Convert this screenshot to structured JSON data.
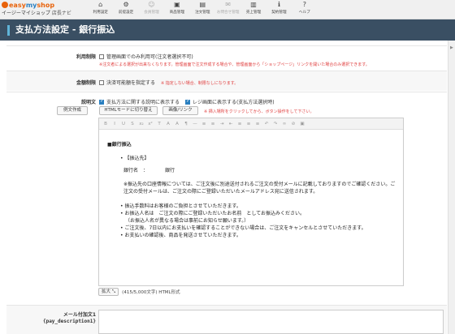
{
  "logo": {
    "brand_a": "easy",
    "brand_b": "my",
    "brand_c": "shop",
    "subtitle": "イージーマイショップ",
    "navi": "店長ナビ"
  },
  "nav": [
    {
      "label": "利用設定",
      "icon": "home-icon",
      "enabled": true
    },
    {
      "label": "前提設定",
      "icon": "gear-icon",
      "enabled": true
    },
    {
      "label": "会員管理",
      "icon": "user-icon",
      "enabled": false
    },
    {
      "label": "商品管理",
      "icon": "box-icon",
      "enabled": true
    },
    {
      "label": "注文管理",
      "icon": "document-icon",
      "enabled": true
    },
    {
      "label": "お問合せ管理",
      "icon": "mail-icon",
      "enabled": false
    },
    {
      "label": "売上管理",
      "icon": "bar-chart-icon",
      "enabled": true
    },
    {
      "label": "契約管理",
      "icon": "info-icon",
      "enabled": true
    },
    {
      "label": "ヘルプ",
      "icon": "help-icon",
      "enabled": true
    }
  ],
  "page_title": "支払方法設定 - 銀行振込",
  "usage": {
    "label": "利用制限",
    "option": "管理画面でのみ利用可(注文者選択不可)",
    "note": "※注文者による選択が出来なくなります。管理画面で注文作成する場合や、管理画面から「ショップページ」リンクを開いた場合のみ選択できます。"
  },
  "amount": {
    "label": "金額制限",
    "option": "決済可能額を指定する",
    "note": "※ 指定しない場合、制限なしになります。"
  },
  "desc": {
    "label": "説明文",
    "example_btn": "例文作成",
    "opt1": "支払方法に関する説明に表示する",
    "opt2": "レジ画面に表示する(支払方法選択時)",
    "html_btn": "HTMLモードに切り替え",
    "image_btn": "画像/リンク",
    "note": "※ 挿入場所をクリックしてから、ボタン操作をして下さい。"
  },
  "editor": {
    "title": "■銀行振込",
    "bullet1": "【振込先】",
    "bank_name": "銀行名　：　　　　銀行",
    "account_note": "※振込先の口座情報については、ご注文後に別途送付されるご注文の受付メールに記載しておりますのでご確認ください。ご注文の受付メールは、ご注文の際にご登録いただいたメールアドレス宛に送信されます。",
    "items": [
      "振込手数料はお客様のご負担とさせていただきます。",
      "お振込人名は　ご注文の際にご登録いただいたお名前　としてお振込みください。",
      "（お振込人名が異なる場合は事前にお知らせ願います。）",
      "ご注文後、7日以内にお支払いを確認することができない場合は、ご注文をキャンセルとさせていただきます。",
      "お支払いの確認後、商品を発送させていただきます。"
    ]
  },
  "status": {
    "expand": "拡大",
    "count": "(415/5,000文字) HTML形式"
  },
  "mail": {
    "label": "メール付加文1",
    "code": "{pay_description1}"
  }
}
